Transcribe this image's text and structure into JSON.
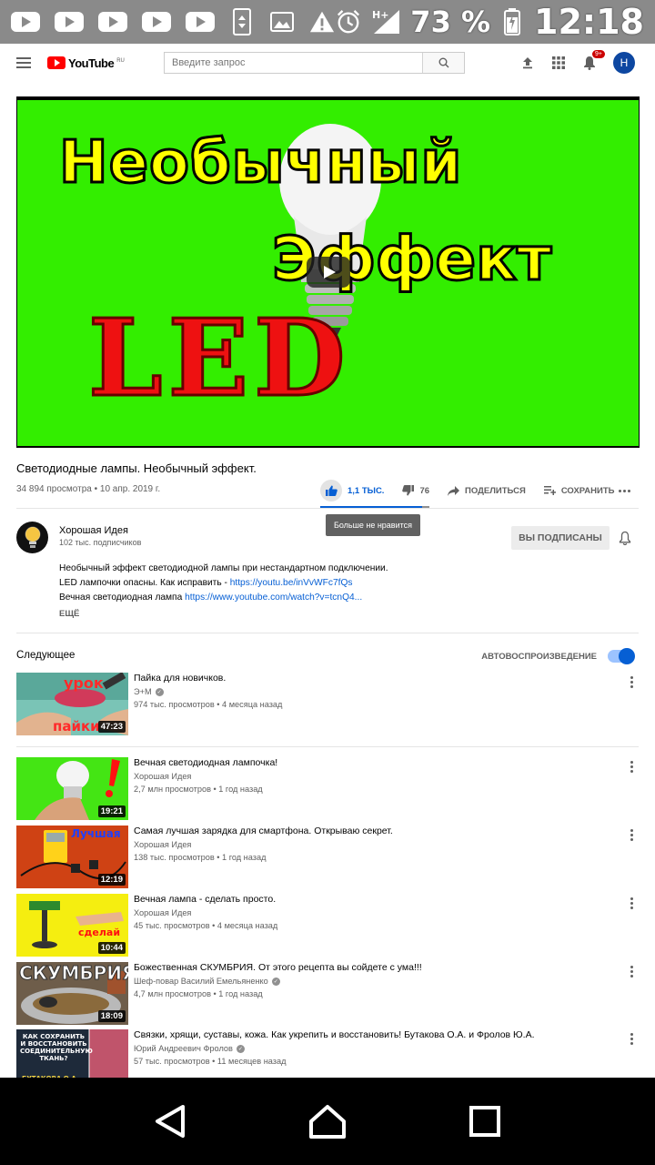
{
  "status_bar": {
    "battery": "73 %",
    "time": "12:18",
    "network": "H+"
  },
  "header": {
    "logo_text": "YouTube",
    "logo_region": "RU",
    "search_placeholder": "Введите запрос",
    "notification_count": "9+",
    "avatar_letter": "H"
  },
  "player": {
    "thumb_line1": "Необычный",
    "thumb_line2": "Эффект",
    "thumb_line3": "LED"
  },
  "video": {
    "title": "Светодиодные лампы. Необычный эффект.",
    "meta": "34 894 просмотра • 10 апр. 2019 г.",
    "likes": "1,1 ТЫС.",
    "dislikes": "76",
    "share_label": "ПОДЕЛИТЬСЯ",
    "save_label": "СОХРАНИТЬ",
    "tooltip": "Больше не нравится",
    "like_ratio": 0.93
  },
  "channel": {
    "name": "Хорошая Идея",
    "subscribers": "102 тыс. подписчиков",
    "subscribe_label": "ВЫ ПОДПИСАНЫ"
  },
  "description": {
    "line1": "Необычный эффект светодиодной лампы при нестандартном подключении.",
    "line2_text": " LED лампочки опасны. Как исправить - ",
    "line2_link": "https://youtu.be/inVvWFc7fQs",
    "line3_text": "Вечная светодиодная лампа ",
    "line3_link": "https://www.youtube.com/watch?v=tcnQ4...",
    "more_label": "ЕЩЁ"
  },
  "up_next": {
    "title": "Следующее",
    "autoplay_label": "АВТОВОСПРОИЗВЕДЕНИЕ",
    "autoplay_on": true
  },
  "videos": [
    {
      "title": "Пайка для новичков.",
      "channel": "Э+М",
      "verified": true,
      "stats": "974 тыс. просмотров • 4 месяца назад",
      "duration": "47:23",
      "thumb_text": "урок",
      "thumb_text2": "пайки"
    },
    {
      "title": "Вечная светодиодная лампочка!",
      "channel": "Хорошая Идея",
      "verified": false,
      "stats": "2,7 млн просмотров • 1 год назад",
      "duration": "19:21"
    },
    {
      "title": "Самая лучшая зарядка для смартфона. Открываю секрет.",
      "channel": "Хорошая Идея",
      "verified": false,
      "stats": "138 тыс. просмотров • 1 год назад",
      "duration": "12:19",
      "thumb_text": "Лучшая"
    },
    {
      "title": "Вечная лампа - сделать просто.",
      "channel": "Хорошая Идея",
      "verified": false,
      "stats": "45 тыс. просмотров • 4 месяца назад",
      "duration": "10:44",
      "thumb_text": "сделай"
    },
    {
      "title": "Божественная СКУМБРИЯ. От этого рецепта вы сойдете с ума!!!",
      "channel": "Шеф-повар Василий Емельяненко",
      "verified": true,
      "stats": "4,7 млн просмотров • 1 год назад",
      "duration": "18:09",
      "thumb_text": "СКУМБРИЯ"
    },
    {
      "title": "Связки, хрящи, суставы, кожа. Как укрепить и восстановить! Бутакова О.А. и Фролов Ю.А.",
      "channel": "Юрий Андреевич Фролов",
      "verified": true,
      "stats": "57 тыс. просмотров • 11 месяцев назад",
      "duration": "",
      "thumb_text": "КАК СОХРАНИТЬ И ВОССТАНОВИТЬ СОЕДИНИТЕЛЬНУЮ ТКАНЬ?",
      "thumb_text2": "БУТАКОВА О.А."
    }
  ]
}
